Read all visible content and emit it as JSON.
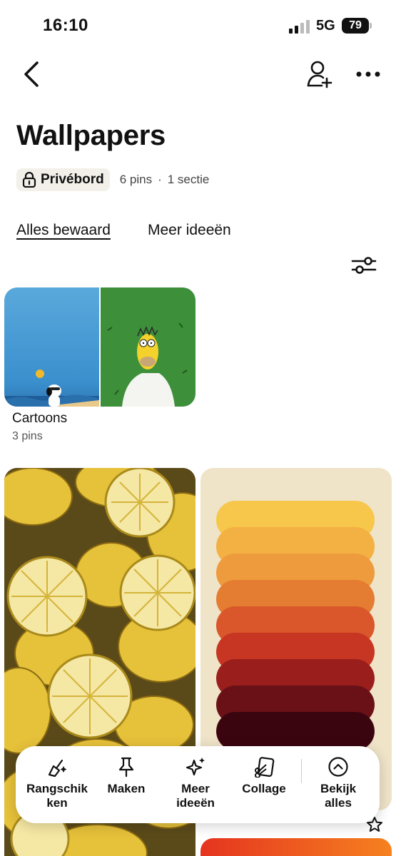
{
  "status": {
    "time": "16:10",
    "network": "5G",
    "battery": "79"
  },
  "board": {
    "title": "Wallpapers",
    "privacy": "Privébord",
    "pin_count": "6 pins",
    "section_count": "1 sectie"
  },
  "tabs": [
    {
      "label": "Alles bewaard",
      "active": true
    },
    {
      "label": "Meer ideeën",
      "active": false
    }
  ],
  "section": {
    "title": "Cartoons",
    "pins": "3 pins"
  },
  "palette_colors": [
    "#f6c74a",
    "#f3b043",
    "#ee9b3d",
    "#e47c32",
    "#d9572a",
    "#c73623",
    "#9a1f1c",
    "#6a1117",
    "#3b0510"
  ],
  "action_bar": {
    "items": [
      {
        "label": "Rangschik\nken",
        "icon": "sparkle-broom-icon"
      },
      {
        "label": "Maken",
        "icon": "pin-icon"
      },
      {
        "label": "Meer\nideeën",
        "icon": "sparkle-icon"
      },
      {
        "label": "Collage",
        "icon": "collage-scissors-icon"
      },
      {
        "label": "Bekijk\nalles",
        "icon": "chevron-up-circle-icon"
      }
    ]
  }
}
